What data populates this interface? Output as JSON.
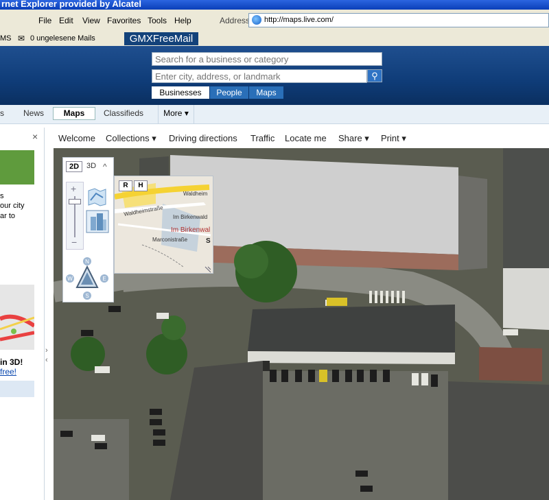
{
  "window": {
    "title": "rnet Explorer provided by Alcatel"
  },
  "menu": {
    "items": [
      "File",
      "Edit",
      "View",
      "Favorites",
      "Tools",
      "Help"
    ],
    "address_label": "Address",
    "address_url": "http://maps.live.com/"
  },
  "links_bar": {
    "ms": "MS",
    "mail": "0 ungelesene Mails",
    "gmx": "GMXFreeMail"
  },
  "search": {
    "business_placeholder": "Search for a business or category",
    "location_placeholder": "Enter city, address, or landmark",
    "tabs": [
      "Businesses",
      "People",
      "Maps"
    ]
  },
  "nav": {
    "tabs": [
      "s",
      "News",
      "Maps",
      "Classifieds",
      "More ▾"
    ]
  },
  "left_pane": {
    "close": "×",
    "lines": [
      "s",
      "our city",
      "ar to"
    ],
    "promo1": "in 3D!",
    "promo2": "free!"
  },
  "map_toolbar": {
    "items": [
      "Welcome",
      "Collections ▾",
      "Driving directions",
      "Traffic",
      "Locate me",
      "Share ▾",
      "Print ▾"
    ]
  },
  "map_ctrl": {
    "view_2d": "2D",
    "view_3d": "3D",
    "collapse": "^",
    "compass": {
      "n": "N",
      "s": "S",
      "e": "E",
      "w": "W"
    }
  },
  "minimap": {
    "btn_r": "R",
    "btn_h": "H",
    "labels": [
      "Waldheimstraße",
      "Waldheim",
      "Im Birkenwald",
      "Im Birkenwal",
      "Marconistraße",
      "S"
    ]
  },
  "colors": {
    "title_bar": "#2b65e0",
    "header": "#0f3c78",
    "accent": "#2f73c4"
  }
}
